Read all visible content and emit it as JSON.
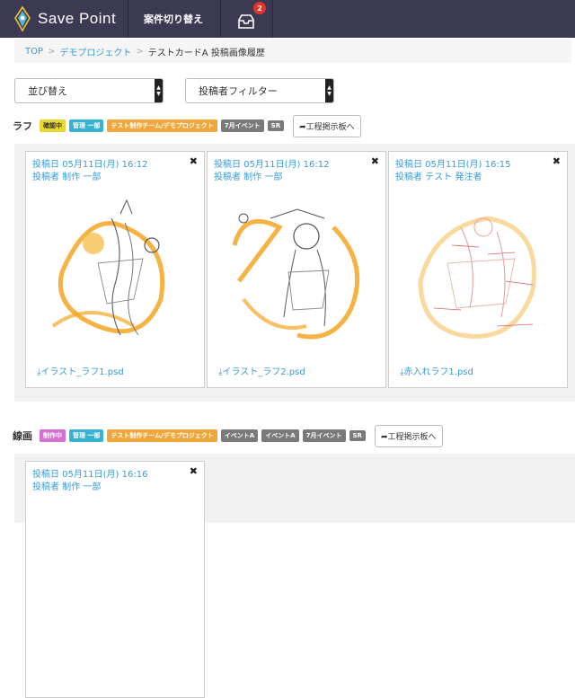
{
  "header": {
    "logo_text": "Save Point",
    "project_switch": "案件切り替え",
    "inbox_count": "2"
  },
  "breadcrumb": {
    "items": [
      "TOP",
      "デモプロジェクト"
    ],
    "separator": ">",
    "current": "テストカードA 投稿画像履歴"
  },
  "filters": {
    "sort_label": "並び替え",
    "poster_filter_label": "投稿者フィルター"
  },
  "sections": [
    {
      "label": "ラフ",
      "tags": [
        {
          "text": "確認中",
          "color": "#e8d931",
          "text_color": "#333333"
        },
        {
          "text": "管理 一部",
          "color": "#39b1d2"
        },
        {
          "text": "テスト制作チーム/デモプロジェクト",
          "color": "#f0a63a"
        },
        {
          "text": "7月イベント",
          "color": "#7a7a7a"
        },
        {
          "text": "SR",
          "color": "#7a7a7a"
        }
      ],
      "board_button": "工程掲示板へ",
      "cards": [
        {
          "date": "投稿日 05月11日(月) 16:12",
          "poster": "投稿者 制作 一部",
          "file": "イラスト_ラフ1.psd"
        },
        {
          "date": "投稿日 05月11日(月) 16:12",
          "poster": "投稿者 制作 一部",
          "file": "イラスト_ラフ2.psd"
        },
        {
          "date": "投稿日 05月11日(月) 16:15",
          "poster": "投稿者 テスト 発注者",
          "file": "赤入れラフ1.psd"
        }
      ]
    },
    {
      "label": "線画",
      "tags": [
        {
          "text": "制作中",
          "color": "#d56fd1"
        },
        {
          "text": "管理 一部",
          "color": "#39b1d2"
        },
        {
          "text": "テスト制作チーム/デモプロジェクト",
          "color": "#f0a63a"
        },
        {
          "text": "イベントA",
          "color": "#7a7a7a"
        },
        {
          "text": "イベントA",
          "color": "#7a7a7a"
        },
        {
          "text": "7月イベント",
          "color": "#7a7a7a"
        },
        {
          "text": "SR",
          "color": "#7a7a7a"
        }
      ],
      "board_button": "工程掲示板へ",
      "cards": [
        {
          "date": "投稿日 05月11日(月) 16:16",
          "poster": "投稿者 制作 一部",
          "file": ""
        }
      ]
    }
  ],
  "colors": {
    "header_bg": "#3c3a52",
    "link": "#3a9bd5",
    "sketch_orange": "#f4a521"
  }
}
